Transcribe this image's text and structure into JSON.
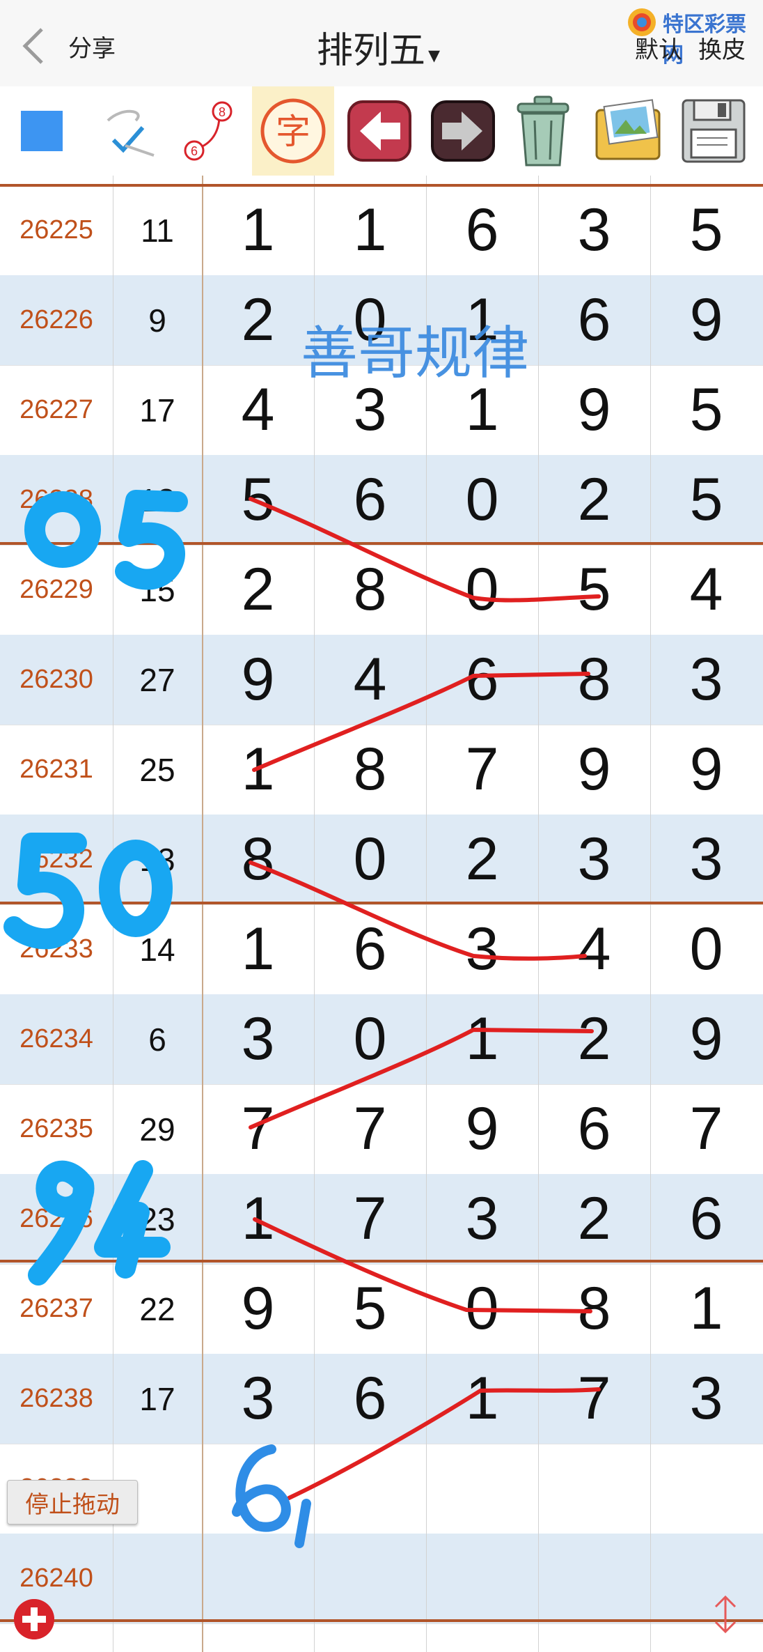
{
  "header": {
    "share_label": "分享",
    "title": "排列五",
    "title_caret": "▾",
    "brand_text": "特区彩票网",
    "skin_default": "默认",
    "skin_change": "换皮"
  },
  "toolbar": {
    "tools": [
      "color-square",
      "pen-check",
      "link-6-8",
      "char-mode",
      "undo",
      "redo",
      "trash",
      "gallery",
      "save"
    ],
    "char_label": "字",
    "link_from": "6",
    "link_to": "8"
  },
  "watermark": "善哥规律",
  "table": {
    "rows": [
      {
        "issue": "26225",
        "sum": "11",
        "digits": [
          "1",
          "1",
          "6",
          "3",
          "5"
        ]
      },
      {
        "issue": "26226",
        "sum": "9",
        "digits": [
          "2",
          "0",
          "1",
          "6",
          "9"
        ]
      },
      {
        "issue": "26227",
        "sum": "17",
        "digits": [
          "4",
          "3",
          "1",
          "9",
          "5"
        ]
      },
      {
        "issue": "26228",
        "sum": "18",
        "digits": [
          "5",
          "6",
          "0",
          "2",
          "5"
        ]
      },
      {
        "issue": "26229",
        "sum": "15",
        "digits": [
          "2",
          "8",
          "0",
          "5",
          "4"
        ]
      },
      {
        "issue": "26230",
        "sum": "27",
        "digits": [
          "9",
          "4",
          "6",
          "8",
          "3"
        ]
      },
      {
        "issue": "26231",
        "sum": "25",
        "digits": [
          "1",
          "8",
          "7",
          "9",
          "9"
        ]
      },
      {
        "issue": "26232",
        "sum": "13",
        "digits": [
          "8",
          "0",
          "2",
          "3",
          "3"
        ]
      },
      {
        "issue": "26233",
        "sum": "14",
        "digits": [
          "1",
          "6",
          "3",
          "4",
          "0"
        ]
      },
      {
        "issue": "26234",
        "sum": "6",
        "digits": [
          "3",
          "0",
          "1",
          "2",
          "9"
        ]
      },
      {
        "issue": "26235",
        "sum": "29",
        "digits": [
          "7",
          "7",
          "9",
          "6",
          "7"
        ]
      },
      {
        "issue": "26236",
        "sum": "23",
        "digits": [
          "1",
          "7",
          "3",
          "2",
          "6"
        ]
      },
      {
        "issue": "26237",
        "sum": "22",
        "digits": [
          "9",
          "5",
          "0",
          "8",
          "1"
        ]
      },
      {
        "issue": "26238",
        "sum": "17",
        "digits": [
          "3",
          "6",
          "1",
          "7",
          "3"
        ]
      },
      {
        "issue": "26239",
        "sum": "",
        "digits": [
          "",
          "",
          "",
          "",
          ""
        ]
      },
      {
        "issue": "26240",
        "sum": "",
        "digits": [
          "",
          "",
          "",
          "",
          ""
        ]
      }
    ]
  },
  "annotations": {
    "blue_marks": [
      "05",
      "50",
      "94",
      "61"
    ]
  },
  "stop_drag_label": "停止拖动",
  "colors": {
    "issue_text": "#c0501a",
    "row_alt": "#deeaf5",
    "separator": "#b1552a",
    "pen_red": "#e02020",
    "pen_blue": "#18a7f2",
    "toolbar_square": "#3d95f2"
  }
}
